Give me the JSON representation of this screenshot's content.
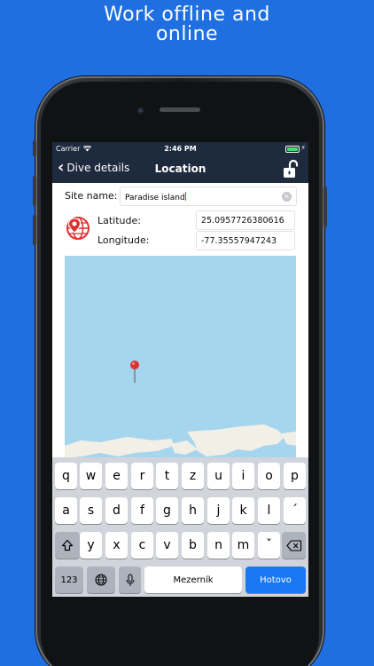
{
  "promo": {
    "line1": "Work offline and",
    "line2": "online"
  },
  "status": {
    "carrier": "Carrier",
    "time": "2:46 PM"
  },
  "nav": {
    "back_label": "Dive details",
    "title": "Location"
  },
  "form": {
    "site_label": "Site name:",
    "site_value": "Paradise island",
    "latitude_label": "Latitude:",
    "latitude_value": "25.0957726380616",
    "longitude_label": "Longitude:",
    "longitude_value": "-77.35557947243"
  },
  "keyboard": {
    "row1": [
      "q",
      "w",
      "e",
      "r",
      "t",
      "z",
      "u",
      "i",
      "o",
      "p"
    ],
    "row2": [
      "a",
      "s",
      "d",
      "f",
      "g",
      "h",
      "j",
      "k",
      "l",
      "´"
    ],
    "row3": [
      "y",
      "x",
      "c",
      "v",
      "b",
      "n",
      "m",
      "ˇ"
    ],
    "numbers_label": "123",
    "space_label": "Mezerník",
    "return_label": "Hotovo"
  },
  "colors": {
    "background": "#1f6fe0",
    "navbar": "#1e2a3e",
    "map_water": "#a6d5ee",
    "accent_red": "#e0312f",
    "return_key": "#1977f3"
  }
}
